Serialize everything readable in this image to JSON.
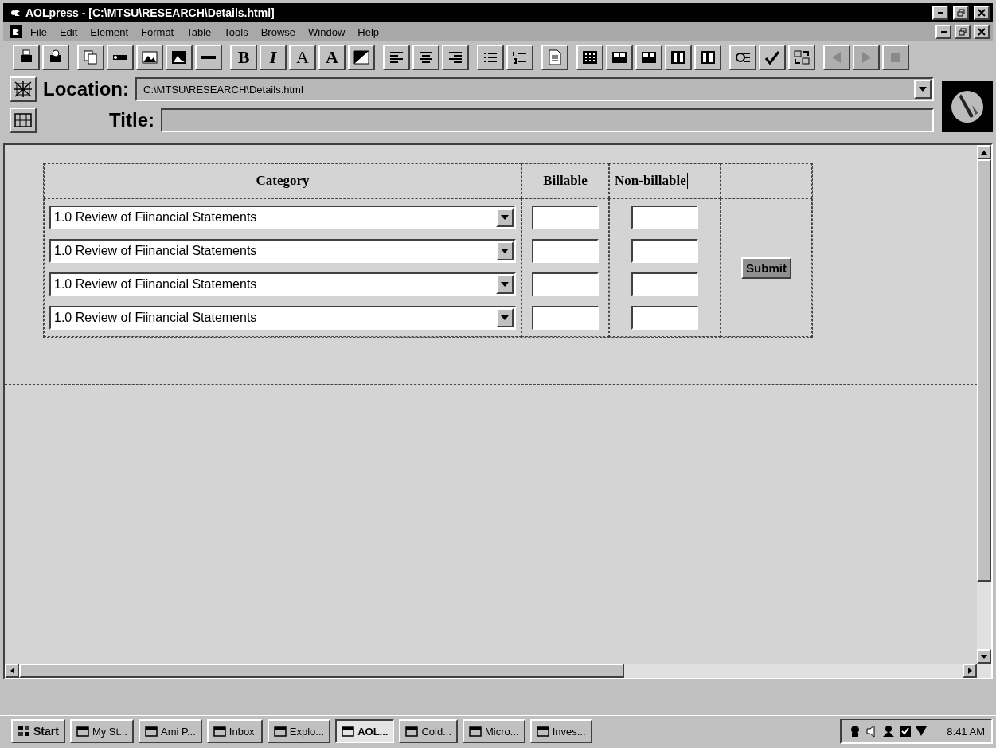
{
  "window": {
    "title": "AOLpress - [C:\\MTSU\\RESEARCH\\Details.html]"
  },
  "menu": [
    "File",
    "Edit",
    "Element",
    "Format",
    "Table",
    "Tools",
    "Browse",
    "Window",
    "Help"
  ],
  "toolbar": [
    [
      {
        "kind": "print",
        "disabled": false
      },
      {
        "kind": "preview",
        "disabled": false
      }
    ],
    [
      {
        "kind": "copy",
        "disabled": false
      },
      {
        "kind": "anchor",
        "disabled": false
      },
      {
        "kind": "image",
        "disabled": false
      },
      {
        "kind": "picture",
        "disabled": false
      },
      {
        "kind": "rule",
        "disabled": false
      }
    ],
    [
      {
        "kind": "bold",
        "label": "B",
        "disabled": false
      },
      {
        "kind": "italic",
        "label": "I",
        "disabled": false
      },
      {
        "kind": "font",
        "label": "A",
        "disabled": false
      },
      {
        "kind": "heavy",
        "label": "A",
        "disabled": false
      },
      {
        "kind": "color",
        "disabled": false
      }
    ],
    [
      {
        "kind": "align-left",
        "disabled": false
      },
      {
        "kind": "align-center",
        "disabled": false
      },
      {
        "kind": "align-right",
        "disabled": false
      }
    ],
    [
      {
        "kind": "bullets",
        "disabled": false
      },
      {
        "kind": "numbers",
        "disabled": false
      }
    ],
    [
      {
        "kind": "page",
        "disabled": false
      }
    ],
    [
      {
        "kind": "table",
        "disabled": false
      },
      {
        "kind": "row",
        "disabled": false
      },
      {
        "kind": "row",
        "disabled": false
      },
      {
        "kind": "column",
        "disabled": false
      },
      {
        "kind": "column",
        "disabled": false
      }
    ],
    [
      {
        "kind": "inspect",
        "disabled": false
      },
      {
        "kind": "spell",
        "disabled": false
      },
      {
        "kind": "swap",
        "disabled": false
      }
    ],
    [
      {
        "kind": "back",
        "disabled": true
      },
      {
        "kind": "forward",
        "disabled": true
      },
      {
        "kind": "stop",
        "disabled": true
      }
    ]
  ],
  "location": {
    "label": "Location:",
    "value": "C:\\MTSU\\RESEARCH\\Details.html"
  },
  "title_field": {
    "label": "Title:"
  },
  "form": {
    "columns": [
      "Category",
      "Billable",
      "Non-billable"
    ],
    "rows": [
      {
        "category": "1.0 Review of Fiinancial Statements"
      },
      {
        "category": "1.0 Review of Fiinancial Statements"
      },
      {
        "category": "1.0 Review of Fiinancial Statements"
      },
      {
        "category": "1.0 Review of Fiinancial Statements"
      }
    ],
    "submit": "Submit"
  },
  "taskbar": {
    "start": "Start",
    "items": [
      {
        "label": "My St...",
        "selected": false
      },
      {
        "label": "Ami P...",
        "selected": false
      },
      {
        "label": "Inbox",
        "selected": false
      },
      {
        "label": "Explo...",
        "selected": false
      },
      {
        "label": "AOL...",
        "selected": true
      },
      {
        "label": "Cold...",
        "selected": false
      },
      {
        "label": "Micro...",
        "selected": false
      },
      {
        "label": "Inves...",
        "selected": false
      }
    ],
    "clock": "8:41 AM"
  }
}
